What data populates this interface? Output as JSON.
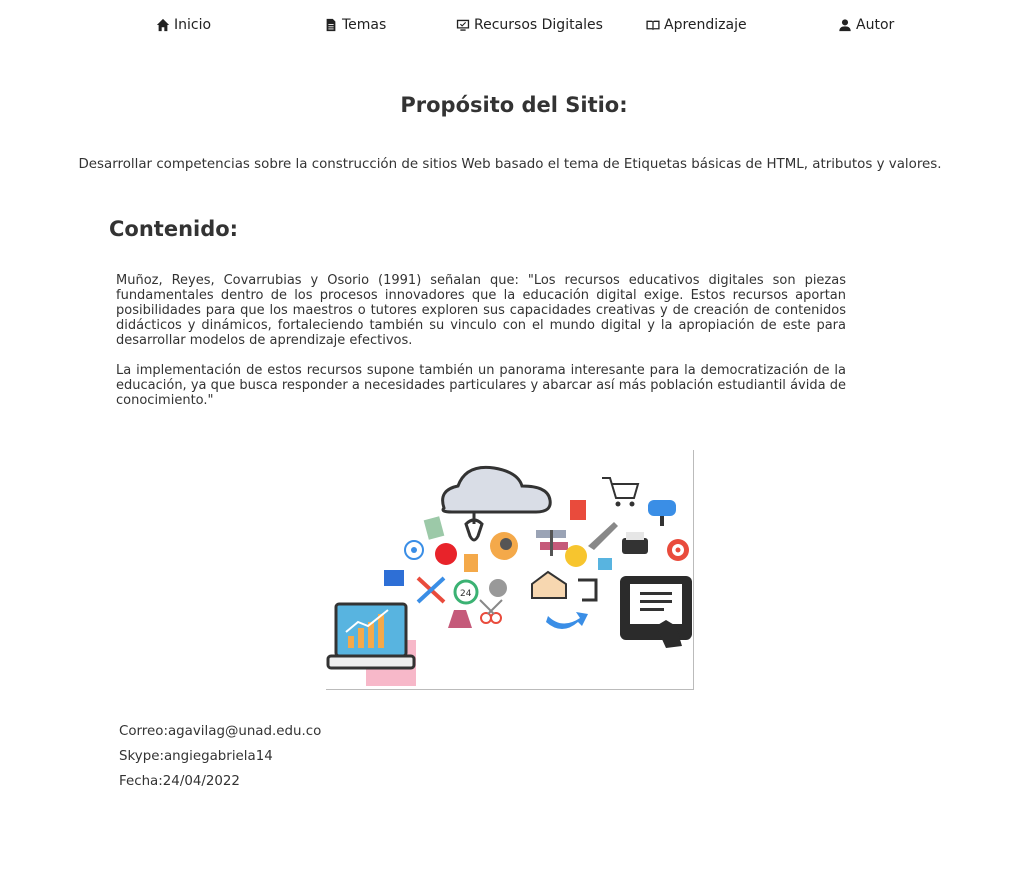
{
  "nav": {
    "items": [
      {
        "label": "Inicio",
        "icon": "home-icon"
      },
      {
        "label": "Temas",
        "icon": "document-icon"
      },
      {
        "label": "Recursos Digitales",
        "icon": "monitor-icon"
      },
      {
        "label": "Aprendizaje",
        "icon": "book-icon"
      },
      {
        "label": "Autor",
        "icon": "user-icon"
      }
    ]
  },
  "purpose": {
    "title": "Propósito del Sitio:",
    "text": "Desarrollar competencias sobre la construcción de sitios Web basado el tema de Etiquetas básicas de HTML, atributos y valores."
  },
  "content": {
    "title": "Contenido:",
    "paragraphs": [
      "Muñoz, Reyes, Covarrubias y Osorio (1991) señalan que: \"Los recursos educativos digitales son piezas fundamentales dentro de los procesos innovadores que la educación digital exige. Estos recursos aportan posibilidades para que los maestros o tutores exploren sus capacidades creativas y de creación de contenidos didácticos y dinámicos, fortaleciendo también su vinculo con el mundo digital y la apropiación de este para desarrollar modelos de aprendizaje efectivos.",
      "La implementación de estos recursos supone también un panorama interesante para la democratización de la educación, ya que busca responder a necesidades particulares y abarcar así más población estudiantil ávida de conocimiento.\""
    ]
  },
  "illustration": {
    "icon": "digital-resources-illustration",
    "colors": {
      "cloud": "#d9dde6",
      "laptop": "#58b4e0",
      "accent_pink": "#f7b8c9",
      "tablet": "#2b2b2b"
    }
  },
  "contact": {
    "email": "Correo:agavilag@unad.edu.co",
    "skype": "Skype:angiegabriela14",
    "date": "Fecha:24/04/2022"
  }
}
